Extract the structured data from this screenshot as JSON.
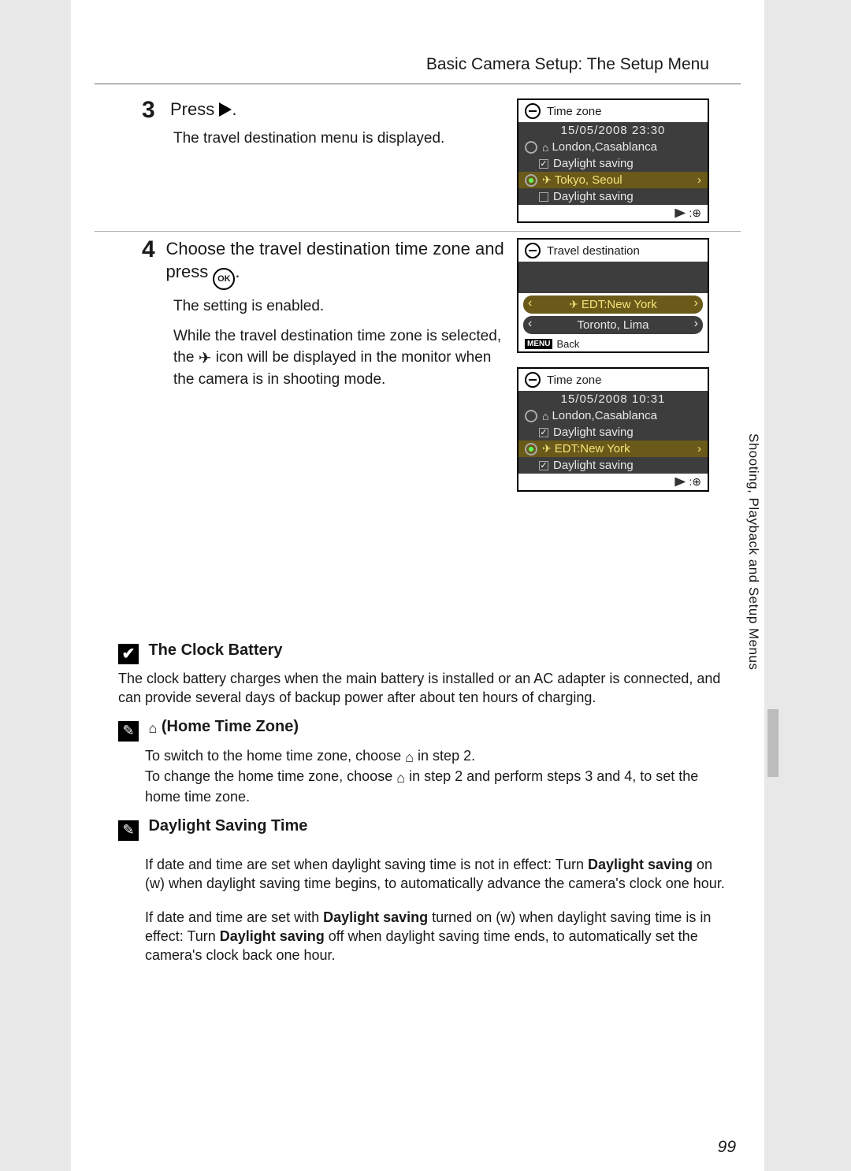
{
  "header": "Basic Camera Setup: The Setup Menu",
  "side_label": "Shooting, Playback and Setup Menus",
  "page_number": "99",
  "step3": {
    "num": "3",
    "title_pre": "Press ",
    "title_post": ".",
    "body": "The travel destination menu is displayed."
  },
  "step4": {
    "num": "4",
    "title_pre": "Choose the travel destination time zone and press ",
    "title_post": ".",
    "body1": "The setting is enabled.",
    "body2_pre": "While the travel destination time zone is selected, the ",
    "body2_post": " icon will be displayed in the monitor when the camera is in shooting mode."
  },
  "notes": {
    "clock": {
      "title": "The Clock Battery",
      "body": "The clock battery charges when the main battery is installed or an AC adapter is connected, and can provide several days of backup power after about ten hours of charging."
    },
    "home": {
      "title": "(Home Time Zone)",
      "line1_pre": "To switch to the home time zone, choose ",
      "line1_post": " in step 2.",
      "line2_pre": "To change the home time zone, choose ",
      "line2_post": " in step 2 and perform steps 3 and 4, to set the home time zone."
    },
    "dst": {
      "title": "Daylight Saving Time",
      "p1_a": "If date and time are set when daylight saving time is not in effect: Turn ",
      "p1_b": "Daylight saving",
      "p1_c": " on (w) when daylight saving time begins, to automatically advance the camera's clock one hour.",
      "p2_a": "If date and time are set with ",
      "p2_b": "Daylight saving",
      "p2_c": " turned on (w) when daylight saving time is in effect: Turn ",
      "p2_d": "Daylight saving",
      "p2_e": " off when daylight saving time ends, to automatically set the camera's clock back one hour."
    }
  },
  "lcd1": {
    "title": "Time zone",
    "date": "15/05/2008   23:30",
    "home": "London,Casablanca",
    "ds": "Daylight saving",
    "dest": "Tokyo, Seoul",
    "ds2": "Daylight saving"
  },
  "lcd2": {
    "title": "Travel destination",
    "item1": "EDT:New York",
    "item2": "Toronto, Lima",
    "back": "Back"
  },
  "lcd3": {
    "title": "Time zone",
    "date": "15/05/2008   10:31",
    "home": "London,Casablanca",
    "ds": "Daylight saving",
    "dest": "EDT:New York",
    "ds2": "Daylight saving"
  }
}
